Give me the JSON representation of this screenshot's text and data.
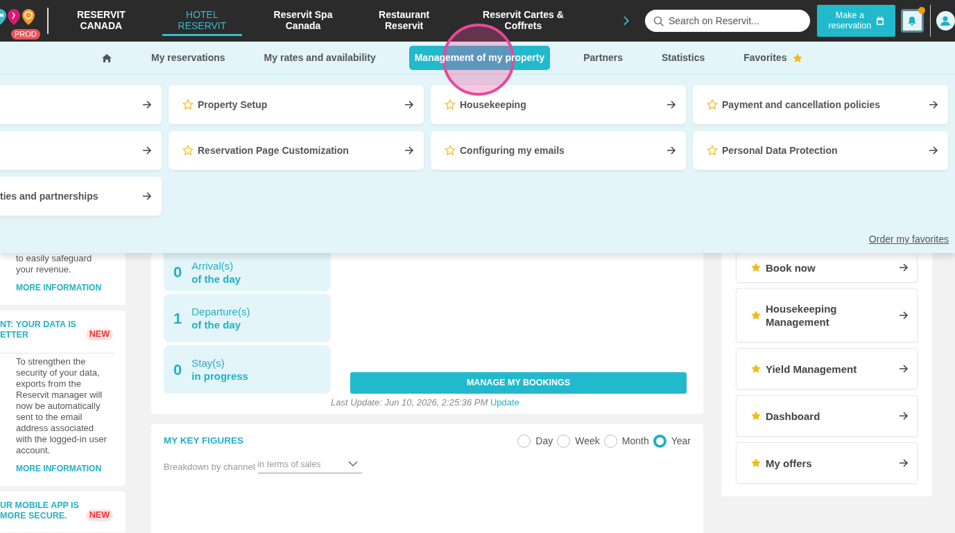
{
  "top_bar": {
    "env_badge": "PROD",
    "products": [
      {
        "label": "RESERVIT CANADA",
        "selected": false
      },
      {
        "label": "HOTEL RESERVIT",
        "selected": true
      },
      {
        "label": "Reservit Spa Canada",
        "selected": false
      },
      {
        "label": "Restaurant Reservit",
        "selected": false
      },
      {
        "label": "Reservit Cartes & Coffrets",
        "selected": false
      }
    ],
    "search": {
      "placeholder": "Search on Reservit..."
    },
    "make_reservation": "Make a reservation",
    "notifications": {
      "unread": true
    }
  },
  "main_nav": [
    {
      "kind": "home",
      "selected": false
    },
    {
      "kind": "link",
      "label": "My reservations",
      "selected": false
    },
    {
      "kind": "link",
      "label": "My rates and availability",
      "selected": false
    },
    {
      "kind": "link",
      "label": "Management of my property",
      "selected": true
    },
    {
      "kind": "link",
      "label": "Partners",
      "selected": false
    },
    {
      "kind": "link",
      "label": "Statistics",
      "selected": false
    },
    {
      "kind": "favorites",
      "label": "Favorites",
      "selected": false
    }
  ],
  "menu_panel": {
    "items": [
      {
        "kind": "clipped"
      },
      {
        "label": "Property Setup",
        "favorite": false
      },
      {
        "label": "Housekeeping",
        "favorite": false
      },
      {
        "label": "Payment and cancellation policies",
        "favorite": false
      },
      {
        "kind": "clipped"
      },
      {
        "label": "Reservation Page Customization",
        "favorite": false
      },
      {
        "label": "Configuring my emails",
        "favorite": false
      },
      {
        "label": "Personal Data Protection",
        "favorite": false
      },
      {
        "kind": "clipped",
        "label": "ties and partnerships"
      }
    ],
    "order_favorites": "Order my favorites"
  },
  "news": [
    {
      "body": "to easily safeguard your revenue.",
      "link": "MORE INFORMATION"
    },
    {
      "title_lines": [
        "NT: YOUR DATA IS",
        "ETTER"
      ],
      "badge": "NEW",
      "body": "To strengthen the security of your data, exports from the Reservit manager will now be automatically sent to the email address associated with the logged-in user account.",
      "link": "MORE INFORMATION"
    },
    {
      "title_lines": [
        "UR MOBILE APP IS",
        "MORE SECURE."
      ],
      "badge": "NEW"
    }
  ],
  "today": {
    "stats": [
      {
        "count": "0",
        "label": "Arrival(s)",
        "sublabel": "of the day"
      },
      {
        "count": "1",
        "label": "Departure(s)",
        "sublabel": "of the day"
      },
      {
        "count": "0",
        "label": "Stay(s)",
        "sublabel": "in progress"
      }
    ],
    "manage_button": "MANAGE MY BOOKINGS",
    "last_update": "Last Update: Jun 10, 2026, 2:25:36 PM",
    "update_link": "Update"
  },
  "key_figures": {
    "title": "MY KEY FIGURES",
    "periods": [
      {
        "label": "Day",
        "selected": false
      },
      {
        "label": "Week",
        "selected": false
      },
      {
        "label": "Month",
        "selected": false
      },
      {
        "label": "Year",
        "selected": true
      }
    ],
    "breakdown": {
      "label": "Breakdown by channel",
      "value": "in terms of sales"
    }
  },
  "favorites": [
    {
      "label": "Book now",
      "favorite": true
    },
    {
      "label": "Housekeeping Management",
      "favorite": true
    },
    {
      "label": "Yield Management",
      "favorite": true
    },
    {
      "label": "Dashboard",
      "favorite": true
    },
    {
      "label": "My offers",
      "favorite": true
    }
  ]
}
